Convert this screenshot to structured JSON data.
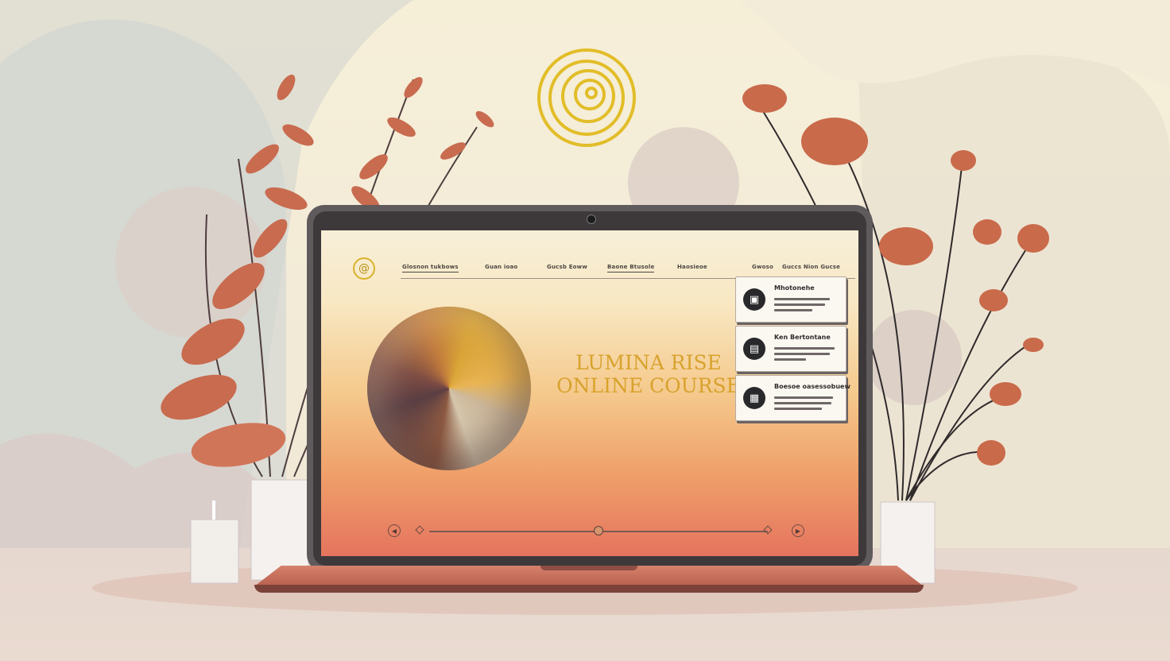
{
  "brand": {
    "logo_glyph": "@",
    "accent_color": "#d8a22c"
  },
  "nav": {
    "items": [
      "Glosnon tukbows",
      "Guan ioao",
      "Gucsb Eoww",
      "Baone Btusole",
      "Haosieoe",
      "Gwoso",
      "Guccs Nion Gucse"
    ]
  },
  "hero": {
    "line1": "LUMINA RISE",
    "line2": "ONLINE COURSE"
  },
  "cards": [
    {
      "title": "Mhotonehe",
      "icon": "certificate-icon",
      "glyph": "▣"
    },
    {
      "title": "Ken Bertontane",
      "icon": "lesson-icon",
      "glyph": "▤"
    },
    {
      "title": "Boesoe oasessobuew",
      "icon": "calendar-icon",
      "glyph": "▦"
    }
  ],
  "player": {
    "progress": 0.5
  },
  "colors": {
    "screen_top": "#f7efd9",
    "screen_bottom": "#e5745e",
    "bezel": "#5f5a5c"
  }
}
